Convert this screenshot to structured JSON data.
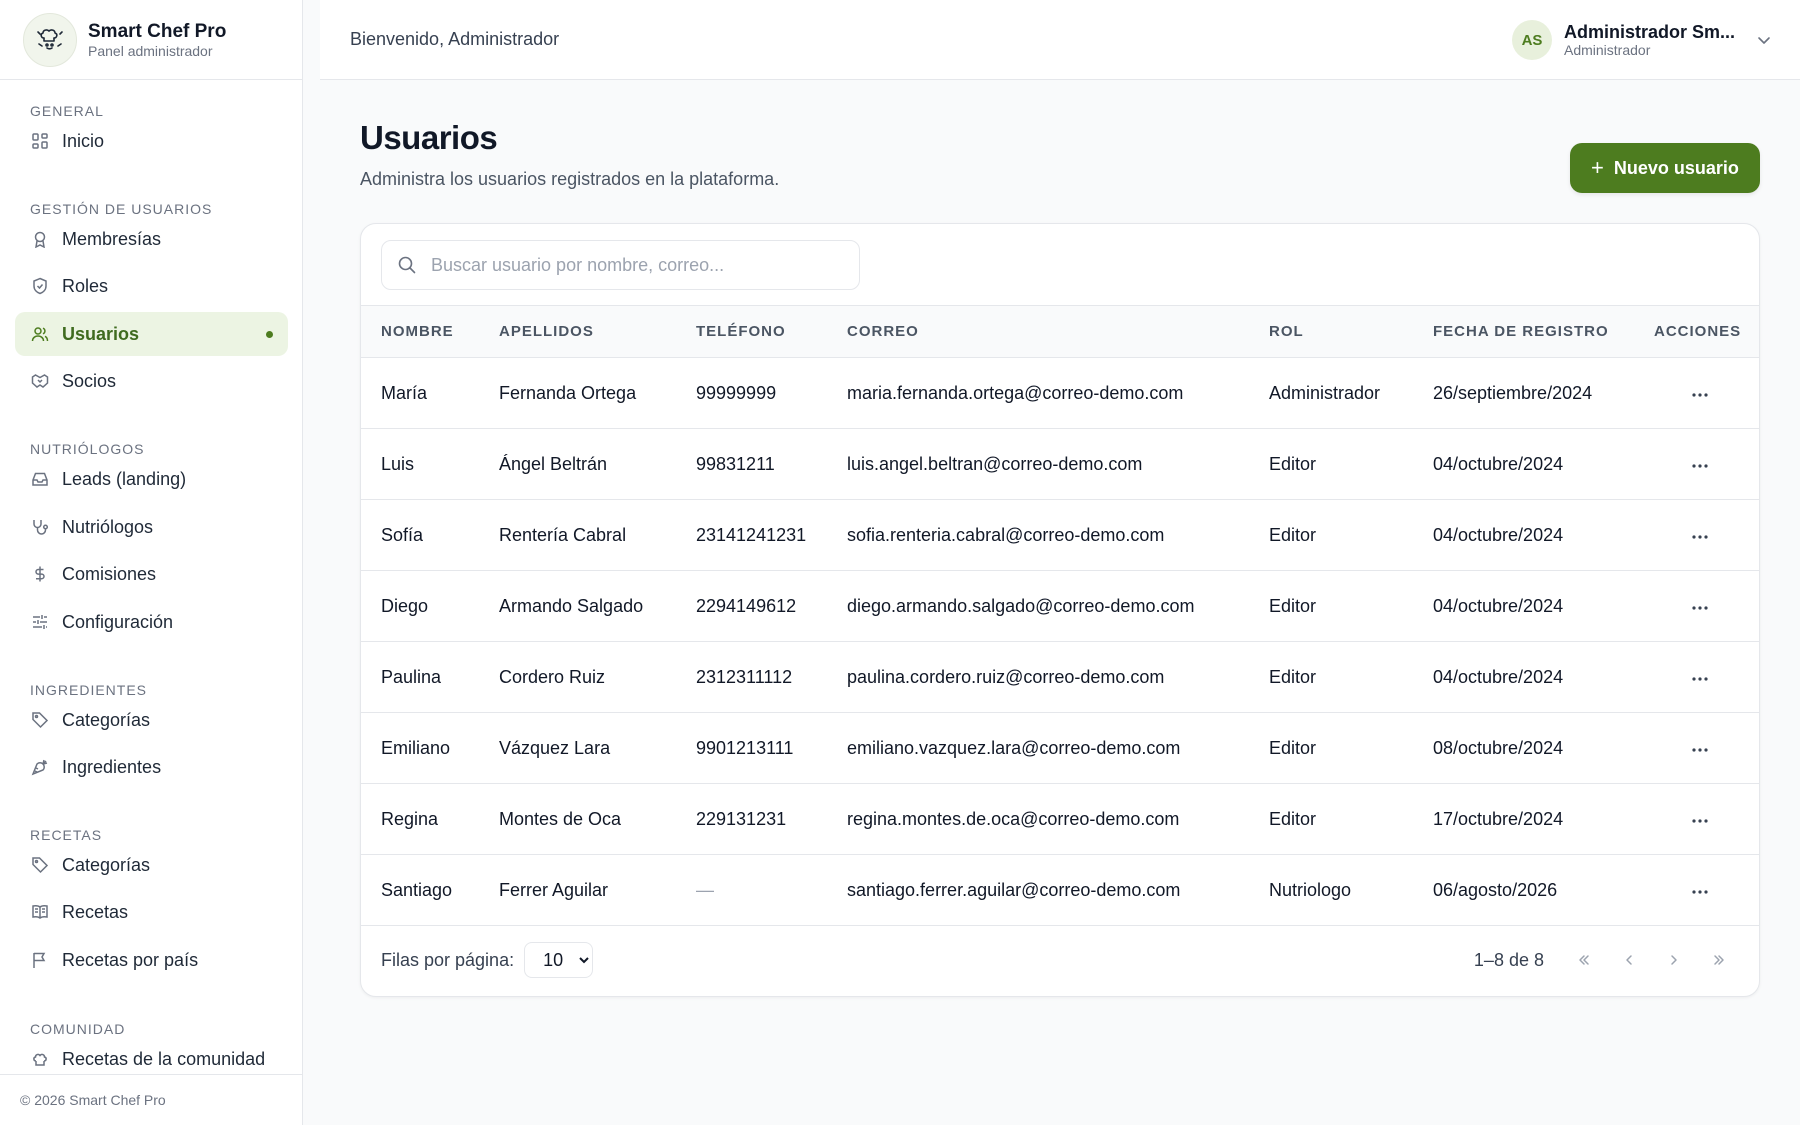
{
  "brand": {
    "name": "Smart Chef Pro",
    "subtitle": "Panel administrador"
  },
  "topbar": {
    "welcome": "Bienvenido, Administrador",
    "user_initials": "AS",
    "user_name": "Administrador Sm...",
    "user_role": "Administrador"
  },
  "sidebar": {
    "sections": {
      "general": "GENERAL",
      "users": "GESTIÓN DE USUARIOS",
      "nutrition": "NUTRIÓLOGOS",
      "ingredients": "INGREDIENTES",
      "recipes": "RECETAS",
      "community": "COMUNIDAD"
    },
    "items": {
      "inicio": "Inicio",
      "membresias": "Membresías",
      "roles": "Roles",
      "usuarios": "Usuarios",
      "socios": "Socios",
      "leads": "Leads (landing)",
      "nutriologos": "Nutriólogos",
      "comisiones": "Comisiones",
      "configuracion": "Configuración",
      "ing_categorias": "Categorías",
      "ingredientes": "Ingredientes",
      "rec_categorias": "Categorías",
      "recetas": "Recetas",
      "recetas_pais": "Recetas por país",
      "recetas_comunidad": "Recetas de la comunidad"
    },
    "active": "Usuarios",
    "footer": "© 2026 Smart Chef Pro"
  },
  "main": {
    "title": "Usuarios",
    "subtitle": "Administra los usuarios registrados en la plataforma.",
    "new_button": "Nuevo usuario",
    "search_placeholder": "Buscar usuario por nombre, correo..."
  },
  "table": {
    "headers": {
      "nombre": "NOMBRE",
      "apellidos": "APELLIDOS",
      "telefono": "TELÉFONO",
      "correo": "CORREO",
      "rol": "ROL",
      "fecha": "FECHA DE REGISTRO",
      "acciones": "ACCIONES"
    },
    "rows": [
      {
        "nombre": "María",
        "apellidos": "Fernanda Ortega",
        "telefono": "99999999",
        "correo": "maria.fernanda.ortega@correo-demo.com",
        "rol": "Administrador",
        "fecha": "26/septiembre/2024"
      },
      {
        "nombre": "Luis",
        "apellidos": "Ángel Beltrán",
        "telefono": "99831211",
        "correo": "luis.angel.beltran@correo-demo.com",
        "rol": "Editor",
        "fecha": "04/octubre/2024"
      },
      {
        "nombre": "Sofía",
        "apellidos": "Rentería Cabral",
        "telefono": "23141241231",
        "correo": "sofia.renteria.cabral@correo-demo.com",
        "rol": "Editor",
        "fecha": "04/octubre/2024"
      },
      {
        "nombre": "Diego",
        "apellidos": "Armando Salgado",
        "telefono": "2294149612",
        "correo": "diego.armando.salgado@correo-demo.com",
        "rol": "Editor",
        "fecha": "04/octubre/2024"
      },
      {
        "nombre": "Paulina",
        "apellidos": "Cordero Ruiz",
        "telefono": "2312311112",
        "correo": "paulina.cordero.ruiz@correo-demo.com",
        "rol": "Editor",
        "fecha": "04/octubre/2024"
      },
      {
        "nombre": "Emiliano",
        "apellidos": "Vázquez Lara",
        "telefono": "9901213111",
        "correo": "emiliano.vazquez.lara@correo-demo.com",
        "rol": "Editor",
        "fecha": "08/octubre/2024"
      },
      {
        "nombre": "Regina",
        "apellidos": "Montes de Oca",
        "telefono": "229131231",
        "correo": "regina.montes.de.oca@correo-demo.com",
        "rol": "Editor",
        "fecha": "17/octubre/2024"
      },
      {
        "nombre": "Santiago",
        "apellidos": "Ferrer Aguilar",
        "telefono": "—",
        "correo": "santiago.ferrer.aguilar@correo-demo.com",
        "rol": "Nutriologo",
        "fecha": "06/agosto/2026"
      }
    ]
  },
  "pagination": {
    "rows_label": "Filas por página:",
    "rows_value": "10",
    "range": "1–8 de 8"
  },
  "colors": {
    "accent": "#4d7c1f",
    "active_bg": "#ecf4e3"
  },
  "icons": [
    "chef-hat-icon",
    "grid-icon",
    "ribbon-icon",
    "shield-icon",
    "users-icon",
    "handshake-icon",
    "inbox-icon",
    "stethoscope-icon",
    "dollar-icon",
    "sliders-icon",
    "tag-icon",
    "carrot-icon",
    "book-icon",
    "flag-icon",
    "chevron-down-icon",
    "search-icon",
    "more-horizontal-icon"
  ]
}
